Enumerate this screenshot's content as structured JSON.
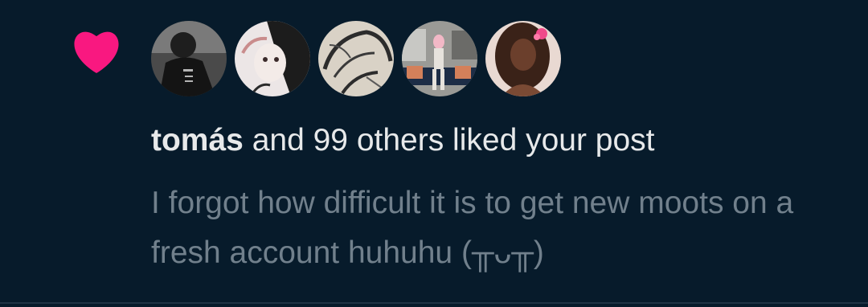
{
  "notification": {
    "type_icon": "heart-icon",
    "accent_color": "#f91880",
    "avatars": [
      {
        "name": "avatar-1",
        "tones": [
          "#3c3c3c",
          "#1a1a1a",
          "#b5b5b5"
        ]
      },
      {
        "name": "avatar-2",
        "tones": [
          "#e9e2e2",
          "#1c1c1c",
          "#c98c8c"
        ]
      },
      {
        "name": "avatar-3",
        "tones": [
          "#d6cfc3",
          "#2c2c2c",
          "#8a8378"
        ]
      },
      {
        "name": "avatar-4",
        "tones": [
          "#8a8a86",
          "#1c2c44",
          "#d4805a"
        ]
      },
      {
        "name": "avatar-5",
        "tones": [
          "#5a3626",
          "#e8c4b2",
          "#f04a8a"
        ]
      }
    ],
    "user": "tomás",
    "rest": " and 99 others liked your post",
    "post_text": "I forgot how difficult it is to get new moots on a fresh account huhuhu (╥ᴗ╥)"
  }
}
